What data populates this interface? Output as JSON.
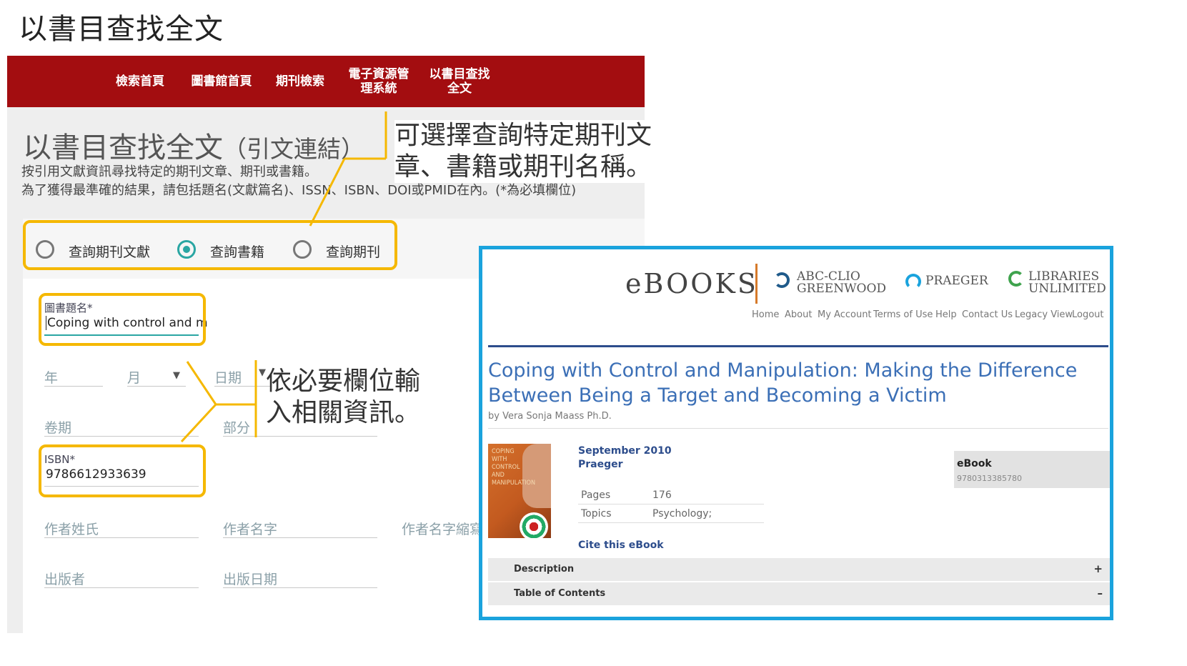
{
  "slide_title": "以書目查找全文",
  "library": {
    "nav": [
      "檢索首頁",
      "圖書館首頁",
      "期刊檢索",
      "電子資源管\n理系統",
      "以書目查找\n全文"
    ],
    "heading": "以書目查找全文",
    "heading_sub": "（引文連結）",
    "desc_line1": "按引用文獻資訊尋找特定的期刊文章、期刊或書籍。",
    "desc_line2": "為了獲得最準確的結果，請包括題名(文獻篇名)、ISSN、ISBN、DOI或PMID在內。(*為必填欄位)",
    "radios": [
      {
        "label": "查詢期刊文獻",
        "selected": false
      },
      {
        "label": "查詢書籍",
        "selected": true
      },
      {
        "label": "查詢期刊",
        "selected": false
      }
    ],
    "form": {
      "title_label": "圖書題名*",
      "title_value": "Coping with control and m",
      "year": "年",
      "month": "月",
      "day": "日期",
      "volume": "卷期",
      "part": "部分",
      "isbn_label": "ISBN*",
      "isbn_value": "9786612933639",
      "author_last": "作者姓氏",
      "author_first": "作者名字",
      "author_initial": "作者名字縮寫",
      "publisher": "出版者",
      "pub_date": "出版日期"
    }
  },
  "callouts": {
    "top": "可選擇查詢特定期刊文章、書籍或期刊名稱。",
    "top_line1": "可選擇查詢特定期刊文",
    "top_line2": "章、書籍或期刊名稱。",
    "middle_line1": "依必要欄位輸",
    "middle_line2": "入相關資訊。"
  },
  "ebook": {
    "logo": "eBOOKS",
    "publishers": [
      {
        "line1": "ABC-CLIO",
        "line2": "GREENWOOD"
      },
      {
        "line1": "PRAEGER",
        "line2": ""
      },
      {
        "line1": "LIBRARIES",
        "line2": "UNLIMITED"
      }
    ],
    "nav": [
      "Home",
      "About",
      "My Account",
      "Terms of Use",
      "Help",
      "Contact Us",
      "Legacy View",
      "Logout"
    ],
    "title": "Coping with Control and Manipulation: Making the Difference Between Being a Target and Becoming a Victim",
    "author": "by Vera Sonja Maass Ph.D.",
    "cover_text": "COPING WITH CONTROL AND MANIPULATION",
    "date": "September 2010",
    "publisher": "Praeger",
    "pages_label": "Pages",
    "pages_value": "176",
    "topics_label": "Topics",
    "topics_value": "Psychology;",
    "cite": "Cite this eBook",
    "format_label": "eBook",
    "format_isbn": "9780313385780",
    "accordion": [
      {
        "label": "Description",
        "symbol": "+"
      },
      {
        "label": "Table of Contents",
        "symbol": "–"
      }
    ]
  },
  "colors": {
    "nav_red": "#a30d10",
    "accent_teal": "#2aa6a3",
    "highlight_yellow": "#f5b800",
    "frame_blue": "#1aa3dd",
    "title_blue": "#3b6fb6"
  }
}
